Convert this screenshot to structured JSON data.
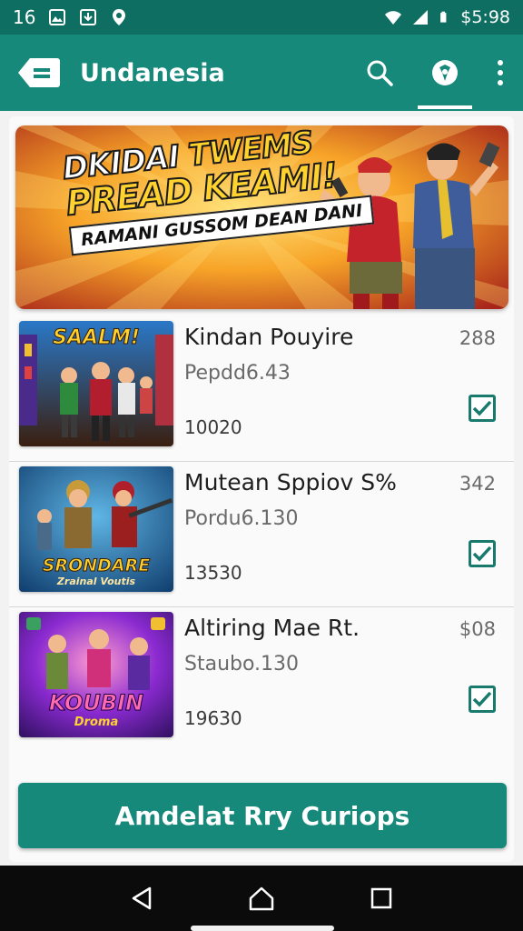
{
  "status_bar": {
    "time": "16",
    "clock": "$5:98",
    "icons": [
      "photo-icon",
      "download-icon",
      "location-icon",
      "wifi-icon",
      "signal-icon",
      "battery-icon"
    ]
  },
  "app_bar": {
    "title": "Undanesia",
    "actions": [
      "search-icon",
      "compass-icon",
      "more-vert-icon"
    ],
    "selected_action": "compass-icon"
  },
  "banner": {
    "line1a": "DKIDAI ",
    "line1b": "TWEMS",
    "line2": "PREAD KEAMI!",
    "line3": "RAMANI GUSSOM DEAN DANI"
  },
  "items": [
    {
      "thumb_label": "SAALM!",
      "thumb_sub": "",
      "title": "Kindan Pouyire",
      "price": "Pepdd6.43",
      "count": "10020",
      "number": "288",
      "checked": true
    },
    {
      "thumb_label": "SRONDARE",
      "thumb_sub": "Zrainal Voutis",
      "title": "Mutean Sppiov S%",
      "price": "Pordu6.130",
      "count": "13530",
      "number": "342",
      "checked": true
    },
    {
      "thumb_label": "KOUBIN",
      "thumb_sub": "Droma",
      "title": "Altiring Mae Rt.",
      "price": "Staubo.130",
      "count": "19630",
      "number": "$08",
      "checked": true
    }
  ],
  "primary_button": {
    "label": "Amdelat Rry Curiops"
  },
  "colors": {
    "primary": "#17897b",
    "primary_dark": "#0f6e62",
    "check": "#177a6d"
  },
  "nav_bar": {
    "buttons": [
      "back-triangle-icon",
      "home-icon",
      "recents-square-icon"
    ]
  }
}
